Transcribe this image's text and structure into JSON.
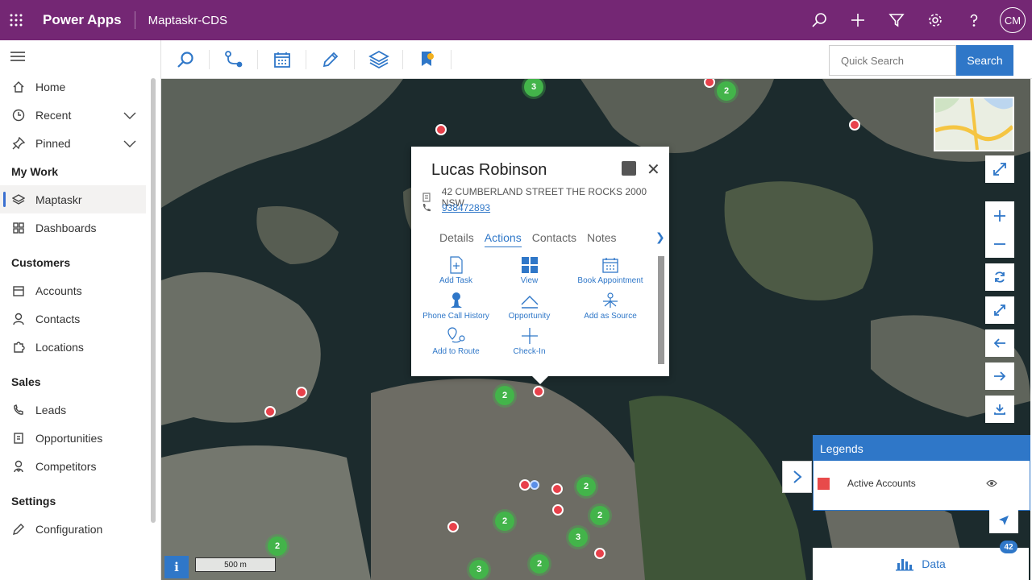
{
  "topbar": {
    "brand": "Power Apps",
    "app_name": "Maptaskr-CDS",
    "avatar_initials": "CM"
  },
  "sidebar": {
    "items": [
      {
        "label": "Home"
      },
      {
        "label": "Recent"
      },
      {
        "label": "Pinned"
      }
    ],
    "sections": [
      {
        "title": "My Work",
        "items": [
          {
            "label": "Maptaskr"
          },
          {
            "label": "Dashboards"
          }
        ]
      },
      {
        "title": "Customers",
        "items": [
          {
            "label": "Accounts"
          },
          {
            "label": "Contacts"
          },
          {
            "label": "Locations"
          }
        ]
      },
      {
        "title": "Sales",
        "items": [
          {
            "label": "Leads"
          },
          {
            "label": "Opportunities"
          },
          {
            "label": "Competitors"
          }
        ]
      },
      {
        "title": "Settings",
        "items": [
          {
            "label": "Configuration"
          }
        ]
      }
    ]
  },
  "toolbar": {
    "search_placeholder": "Quick Search",
    "search_button": "Search"
  },
  "popup": {
    "name": "Lucas Robinson",
    "address": "42 CUMBERLAND STREET THE ROCKS 2000 NSW",
    "phone": "938472893",
    "tabs": [
      "Details",
      "Actions",
      "Contacts",
      "Notes"
    ],
    "actions": [
      "Add Task",
      "View",
      "Book Appointment",
      "Phone Call History",
      "Opportunity",
      "Add as Source",
      "Add to Route",
      "Check-In"
    ]
  },
  "clusters": [
    "3",
    "2",
    "2",
    "2",
    "2",
    "2",
    "3",
    "2",
    "2",
    "3"
  ],
  "legend": {
    "title": "Legends",
    "entry": "Active Accounts",
    "color": "#e84a4a"
  },
  "data_bar": {
    "label": "Data",
    "count": "42"
  },
  "scale": {
    "label": "500 m"
  },
  "info": {
    "label": "i"
  },
  "colors": {
    "accent": "#742774",
    "primary": "#2f77c8"
  }
}
